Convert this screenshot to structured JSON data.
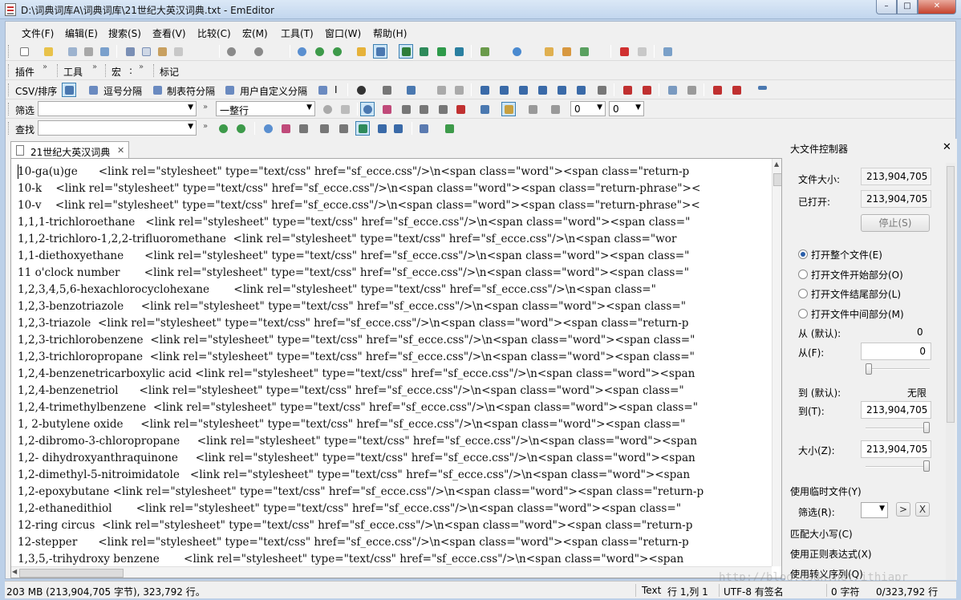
{
  "window": {
    "title": "D:\\词典词库A\\词典词库\\21世纪大英汉词典.txt - EmEditor",
    "min": "–",
    "max": "□",
    "close": "✕"
  },
  "menu": [
    "文件(F)",
    "编辑(E)",
    "搜索(S)",
    "查看(V)",
    "比较(C)",
    "宏(M)",
    "工具(T)",
    "窗口(W)",
    "帮助(H)"
  ],
  "toolbar2": {
    "plugins": "插件",
    "tools": "工具",
    "macro": "宏",
    "macro_sep": ":",
    "bookmark": "标记"
  },
  "toolbar3": {
    "csv": "CSV/排序",
    "comma": "逗号分隔",
    "tab": "制表符分隔",
    "custom": "用户自定义分隔",
    "bar": "I"
  },
  "filterbar": {
    "label": "筛选",
    "mode": "一整行",
    "num1": "0",
    "num2": "0"
  },
  "findbar": {
    "label": "查找"
  },
  "doc_tab": {
    "name": "21世纪大英汉词典",
    "close": "✕"
  },
  "editor_lines": [
    "10-ga(u)ge      <link rel=\"stylesheet\" type=\"text/css\" href=\"sf_ecce.css\"/>\\n<span class=\"word\"><span class=\"return-p",
    "10-k    <link rel=\"stylesheet\" type=\"text/css\" href=\"sf_ecce.css\"/>\\n<span class=\"word\"><span class=\"return-phrase\"><",
    "10-v    <link rel=\"stylesheet\" type=\"text/css\" href=\"sf_ecce.css\"/>\\n<span class=\"word\"><span class=\"return-phrase\"><",
    "1,1,1-trichloroethane   <link rel=\"stylesheet\" type=\"text/css\" href=\"sf_ecce.css\"/>\\n<span class=\"word\"><span class=\"",
    "1,1,2-trichloro-1,2,2-trifluoromethane  <link rel=\"stylesheet\" type=\"text/css\" href=\"sf_ecce.css\"/>\\n<span class=\"wor",
    "1,1-diethoxyethane      <link rel=\"stylesheet\" type=\"text/css\" href=\"sf_ecce.css\"/>\\n<span class=\"word\"><span class=\"",
    "11 o'clock number       <link rel=\"stylesheet\" type=\"text/css\" href=\"sf_ecce.css\"/>\\n<span class=\"word\"><span class=\"",
    "1,2,3,4,5,6-hexachlorocyclohexane       <link rel=\"stylesheet\" type=\"text/css\" href=\"sf_ecce.css\"/>\\n<span class=\"",
    "1,2,3-benzotriazole     <link rel=\"stylesheet\" type=\"text/css\" href=\"sf_ecce.css\"/>\\n<span class=\"word\"><span class=\"",
    "1,2,3-triazole  <link rel=\"stylesheet\" type=\"text/css\" href=\"sf_ecce.css\"/>\\n<span class=\"word\"><span class=\"return-p",
    "1,2,3-trichlorobenzene  <link rel=\"stylesheet\" type=\"text/css\" href=\"sf_ecce.css\"/>\\n<span class=\"word\"><span class=\"",
    "1,2,3-trichloropropane  <link rel=\"stylesheet\" type=\"text/css\" href=\"sf_ecce.css\"/>\\n<span class=\"word\"><span class=\"",
    "1,2,4-benzenetricarboxylic acid <link rel=\"stylesheet\" type=\"text/css\" href=\"sf_ecce.css\"/>\\n<span class=\"word\"><span",
    "1,2,4-benzenetriol      <link rel=\"stylesheet\" type=\"text/css\" href=\"sf_ecce.css\"/>\\n<span class=\"word\"><span class=\"",
    "1,2,4-trimethylbenzene  <link rel=\"stylesheet\" type=\"text/css\" href=\"sf_ecce.css\"/>\\n<span class=\"word\"><span class=\"",
    "1, 2-butylene oxide     <link rel=\"stylesheet\" type=\"text/css\" href=\"sf_ecce.css\"/>\\n<span class=\"word\"><span class=\"",
    "1,2-dibromo-3-chloropropane     <link rel=\"stylesheet\" type=\"text/css\" href=\"sf_ecce.css\"/>\\n<span class=\"word\"><span",
    "1,2- dihydroxyanthraquinone     <link rel=\"stylesheet\" type=\"text/css\" href=\"sf_ecce.css\"/>\\n<span class=\"word\"><span",
    "1,2-dimethyl-5-nitroimidatole   <link rel=\"stylesheet\" type=\"text/css\" href=\"sf_ecce.css\"/>\\n<span class=\"word\"><span",
    "1,2-epoxybutane <link rel=\"stylesheet\" type=\"text/css\" href=\"sf_ecce.css\"/>\\n<span class=\"word\"><span class=\"return-p",
    "1,2-ethanedithiol       <link rel=\"stylesheet\" type=\"text/css\" href=\"sf_ecce.css\"/>\\n<span class=\"word\"><span class=\"",
    "12-ring circus  <link rel=\"stylesheet\" type=\"text/css\" href=\"sf_ecce.css\"/>\\n<span class=\"word\"><span class=\"return-p",
    "12-stepper      <link rel=\"stylesheet\" type=\"text/css\" href=\"sf_ecce.css\"/>\\n<span class=\"word\"><span class=\"return-p",
    "1,3,5,-trihydroxy benzene       <link rel=\"stylesheet\" type=\"text/css\" href=\"sf_ecce.css\"/>\\n<span class=\"word\"><span"
  ],
  "panel": {
    "title": "大文件控制器",
    "close": "✕",
    "file_size_label": "文件大小:",
    "file_size": "213,904,705",
    "opened_label": "已打开:",
    "opened": "213,904,705",
    "stop": "停止(S)",
    "radio_all": "打开整个文件(E)",
    "radio_begin": "打开文件开始部分(O)",
    "radio_end": "打开文件结尾部分(L)",
    "radio_middle": "打开文件中间部分(M)",
    "from_default_label": "从 (默认):",
    "from_default": "0",
    "from_label": "从(F):",
    "from_value": "0",
    "to_default_label": "到 (默认):",
    "to_default": "无限",
    "to_label": "到(T):",
    "to_value": "213,904,705",
    "size_label": "大小(Z):",
    "size_value": "213,904,705",
    "temp_file": "使用临时文件(Y)",
    "filter_label": "筛选(R):",
    "go": ">",
    "clear": "X",
    "match_case": "匹配大小写(C)",
    "regex": "使用正则表达式(X)",
    "escape": "使用转义序列(Q)"
  },
  "status": {
    "size": "203 MB (213,904,705 字节), 323,792 行。",
    "mode": "Text",
    "pos": "行 1,列 1",
    "encoding": "UTF-8 有签名",
    "chars": "0 字符",
    "lines": "0/323,792 行"
  },
  "watermark": "http://blog.csdn.net/ithiapr"
}
